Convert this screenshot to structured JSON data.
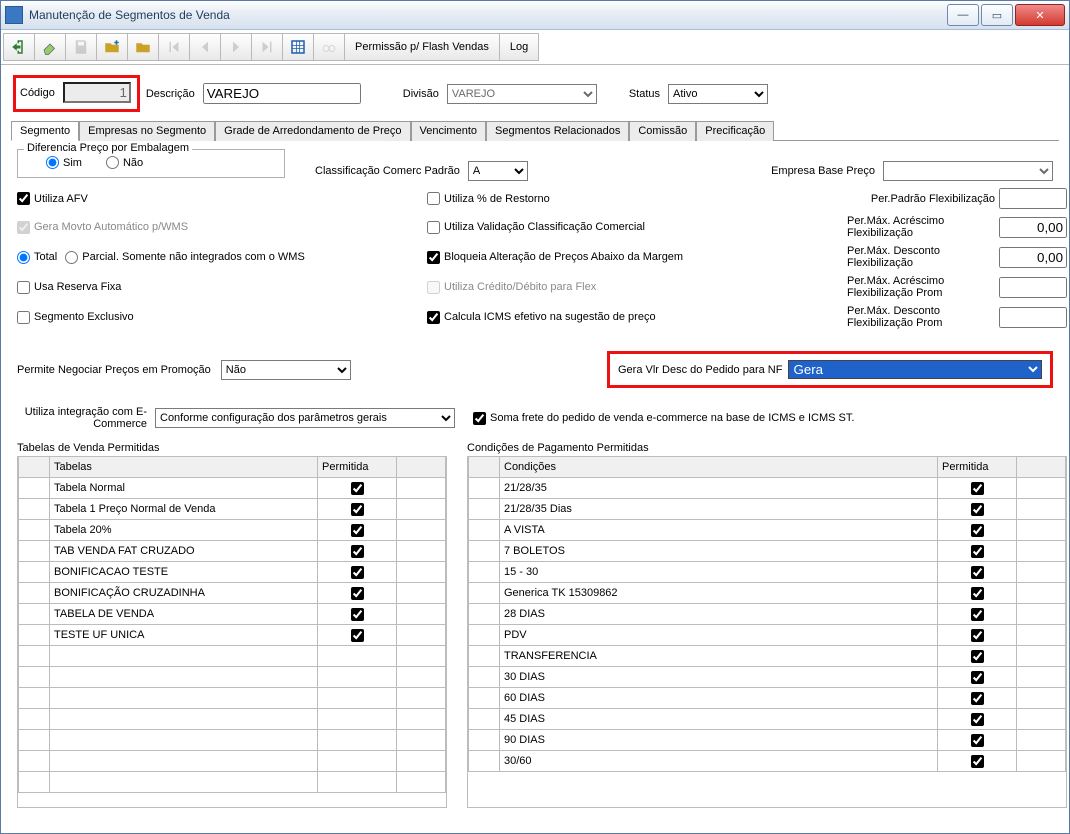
{
  "window": {
    "title": "Manutenção de Segmentos de Venda"
  },
  "toolbar": {
    "permissao": "Permissão p/ Flash Vendas",
    "log": "Log"
  },
  "header": {
    "codigo_label": "Código",
    "codigo_value": "1",
    "descricao_label": "Descrição",
    "descricao_value": "VAREJO",
    "divisao_label": "Divisão",
    "divisao_value": "VAREJO",
    "status_label": "Status",
    "status_value": "Ativo"
  },
  "tabs": [
    "Segmento",
    "Empresas no Segmento",
    "Grade de Arredondamento de Preço",
    "Vencimento",
    "Segmentos Relacionados",
    "Comissão",
    "Precificação"
  ],
  "diff": {
    "legend": "Diferencia Preço por Embalagem",
    "sim": "Sim",
    "nao": "Não"
  },
  "classif": {
    "label": "Classificação Comerc Padrão",
    "value": "A"
  },
  "empresa_base": {
    "label": "Empresa Base Preço",
    "value": ""
  },
  "flags": {
    "utiliza_afv": "Utiliza AFV",
    "gera_movto": "Gera Movto Automático p/WMS",
    "total": "Total",
    "parcial": "Parcial. Somente não integrados com o WMS",
    "usa_reserva": "Usa Reserva Fixa",
    "seg_exclusivo": "Segmento Exclusivo",
    "util_pct_estorno": "Utiliza % de Restorno",
    "util_valid_class": "Utiliza Validação Classificação Comercial",
    "bloqueia_alt": "Bloqueia Alteração de Preços Abaixo da Margem",
    "util_cred_deb": "Utiliza Crédito/Débito para Flex",
    "calc_icms": "Calcula ICMS efetivo na sugestão de preço"
  },
  "flex": {
    "l1": "Per.Padrão Flexibilização",
    "v1": "",
    "l2": "Per.Máx. Acréscimo Flexibilização",
    "v2": "0,00",
    "l3": "Per.Máx. Desconto Flexibilização",
    "v3": "0,00",
    "l4": "Per.Máx. Acréscimo Flexibilização Prom",
    "v4": "",
    "l5": "Per.Máx. Desconto Flexibilização Prom",
    "v5": ""
  },
  "promo": {
    "label": "Permite Negociar Preços em Promoção",
    "value": "Não"
  },
  "geravlr": {
    "label": "Gera Vlr Desc do Pedido para NF",
    "value": "Gera"
  },
  "ecom": {
    "label": "Utiliza integração com E-Commerce",
    "value": "Conforme configuração dos parâmetros gerais",
    "soma_frete": "Soma frete do pedido de venda e-commerce na base de ICMS e ICMS ST."
  },
  "tables_caption": "Tabelas de Venda Permitidas",
  "cond_caption": "Condições de Pagamento Permitidas",
  "col_tabelas": "Tabelas",
  "col_permitida": "Permitida",
  "col_condicoes": "Condições",
  "tabelas": [
    {
      "nome": "Tabela Normal",
      "perm": true
    },
    {
      "nome": "Tabela 1 Preço Normal de Venda",
      "perm": true
    },
    {
      "nome": "Tabela 20%",
      "perm": true
    },
    {
      "nome": "TAB VENDA FAT CRUZADO",
      "perm": true
    },
    {
      "nome": "BONIFICACAO TESTE",
      "perm": true
    },
    {
      "nome": "BONIFICAÇÃO CRUZADINHA",
      "perm": true
    },
    {
      "nome": "TABELA DE VENDA",
      "perm": true
    },
    {
      "nome": "TESTE UF UNICA",
      "perm": true
    },
    {
      "nome": "",
      "perm": null
    },
    {
      "nome": "",
      "perm": null
    },
    {
      "nome": "",
      "perm": null
    },
    {
      "nome": "",
      "perm": null
    },
    {
      "nome": "",
      "perm": null
    },
    {
      "nome": "",
      "perm": null
    },
    {
      "nome": "",
      "perm": null
    }
  ],
  "condicoes": [
    {
      "nome": "21/28/35",
      "perm": true
    },
    {
      "nome": "21/28/35 Dias",
      "perm": true
    },
    {
      "nome": "A VISTA",
      "perm": true
    },
    {
      "nome": "7 BOLETOS",
      "perm": true
    },
    {
      "nome": "15 - 30",
      "perm": true
    },
    {
      "nome": "Generica TK 15309862",
      "perm": true
    },
    {
      "nome": "28 DIAS",
      "perm": true
    },
    {
      "nome": "PDV",
      "perm": true
    },
    {
      "nome": "TRANSFERENCIA",
      "perm": true
    },
    {
      "nome": "30 DIAS",
      "perm": true
    },
    {
      "nome": "60 DIAS",
      "perm": true
    },
    {
      "nome": "45 DIAS",
      "perm": true
    },
    {
      "nome": "90 DIAS",
      "perm": true
    },
    {
      "nome": "30/60",
      "perm": true
    }
  ]
}
